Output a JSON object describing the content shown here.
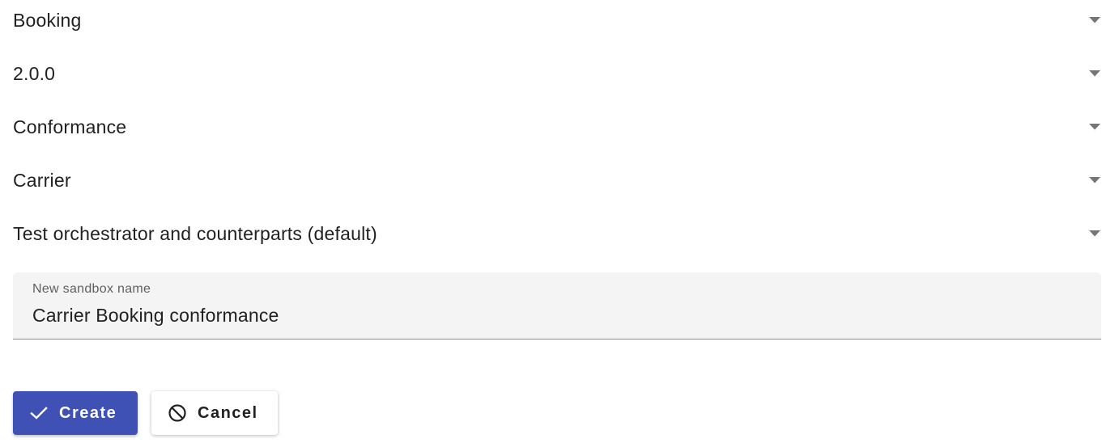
{
  "form": {
    "selects": [
      {
        "value": "Booking",
        "icon": "dropdown-arrow-icon"
      },
      {
        "value": "2.0.0",
        "icon": "dropdown-arrow-icon"
      },
      {
        "value": "Conformance",
        "icon": "dropdown-arrow-icon"
      },
      {
        "value": "Carrier",
        "icon": "dropdown-arrow-icon"
      },
      {
        "value": "Test orchestrator and counterparts (default)",
        "icon": "dropdown-arrow-icon"
      }
    ],
    "sandbox_name": {
      "label": "New sandbox name",
      "value": "Carrier Booking conformance"
    }
  },
  "actions": {
    "create_label": "Create",
    "create_icon": "check-icon",
    "cancel_label": "Cancel",
    "cancel_icon": "block-icon"
  },
  "colors": {
    "primary": "#3f51b5",
    "field_background": "#f4f4f4",
    "arrow": "#757575"
  }
}
